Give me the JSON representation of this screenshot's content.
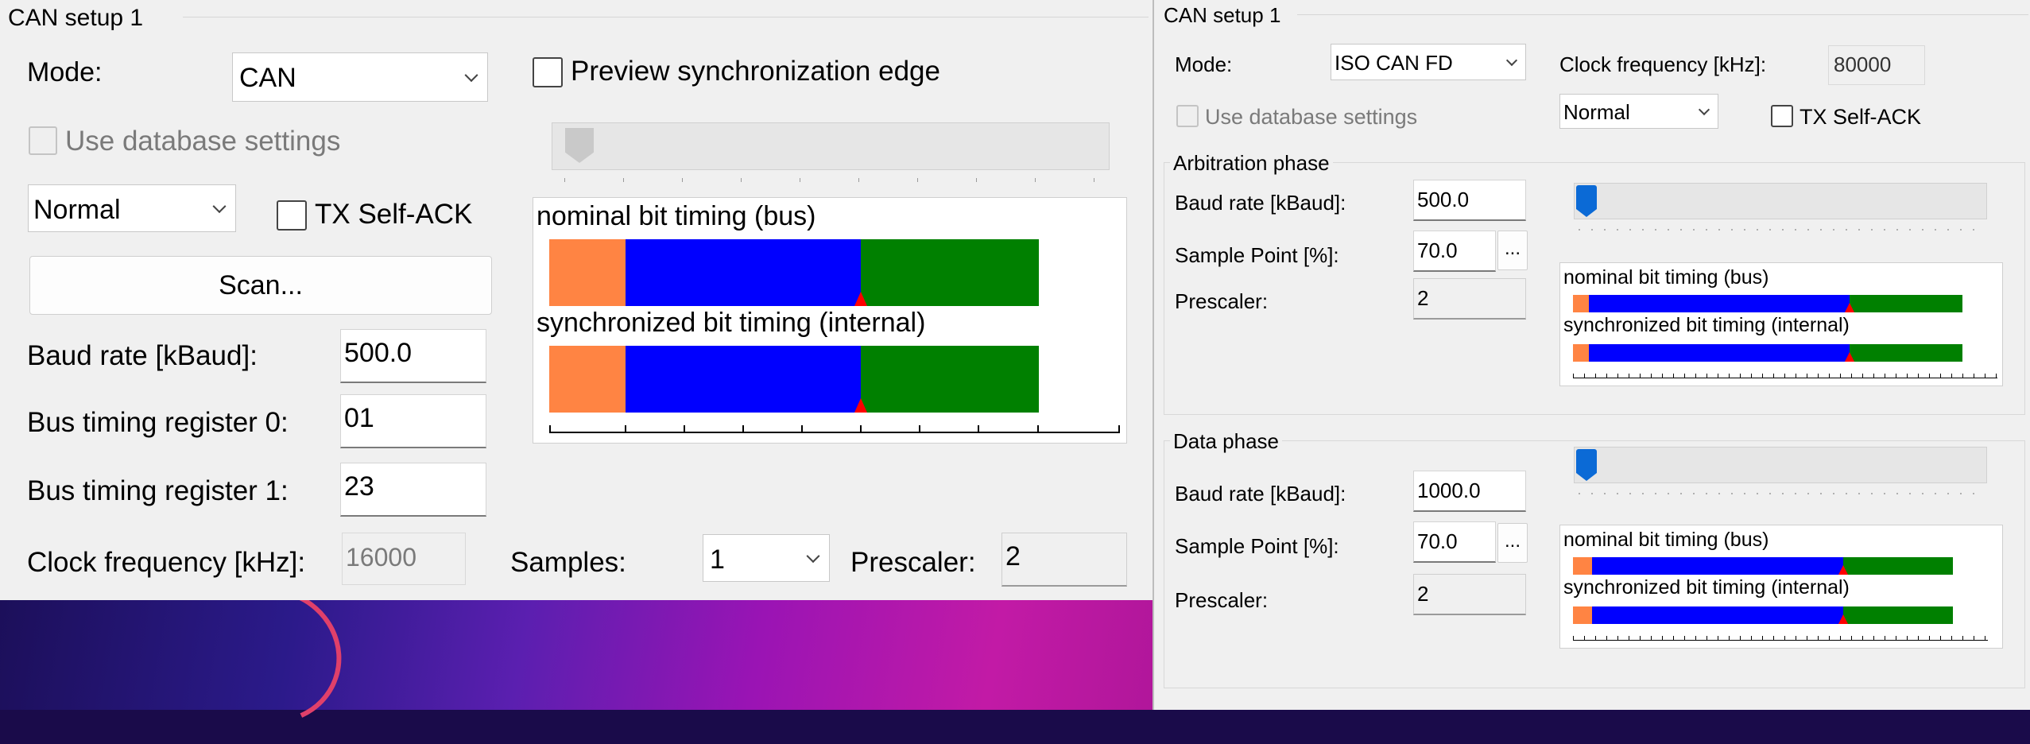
{
  "left": {
    "title": "CAN setup 1",
    "mode_label": "Mode:",
    "mode_value": "CAN",
    "preview_label": "Preview synchronization edge",
    "use_db_label": "Use database settings",
    "normal_value": "Normal",
    "tx_self_ack_label": "TX Self-ACK",
    "scan_label": "Scan...",
    "baud_label": "Baud rate [kBaud]:",
    "baud_value": "500.0",
    "btr0_label": "Bus timing register 0:",
    "btr0_value": "01",
    "btr1_label": "Bus timing register 1:",
    "btr1_value": "23",
    "clock_label": "Clock frequency [kHz]:",
    "clock_value": "16000",
    "samples_label": "Samples:",
    "samples_value": "1",
    "prescaler_label": "Prescaler:",
    "prescaler_value": "2",
    "nominal_label": "nominal bit timing (bus)",
    "sync_label": "synchronized bit timing (internal)"
  },
  "right": {
    "title": "CAN setup 1",
    "mode_label": "Mode:",
    "mode_value": "ISO CAN FD",
    "clock_label": "Clock frequency [kHz]:",
    "clock_value": "80000",
    "use_db_label": "Use database settings",
    "normal_value": "Normal",
    "tx_self_ack_label": "TX Self-ACK",
    "arbitration": {
      "title": "Arbitration phase",
      "baud_label": "Baud rate [kBaud]:",
      "baud_value": "500.0",
      "sample_label": "Sample Point [%]:",
      "sample_value": "70.0",
      "more_label": "...",
      "prescaler_label": "Prescaler:",
      "prescaler_value": "2",
      "nominal_label": "nominal bit timing (bus)",
      "sync_label": "synchronized bit timing (internal)"
    },
    "data": {
      "title": "Data phase",
      "baud_label": "Baud rate [kBaud]:",
      "baud_value": "1000.0",
      "sample_label": "Sample Point [%]:",
      "sample_value": "70.0",
      "more_label": "...",
      "prescaler_label": "Prescaler:",
      "prescaler_value": "2",
      "nominal_label": "nominal bit timing (bus)",
      "sync_label": "synchronized bit timing (internal)"
    }
  },
  "colors": {
    "sync_segment": "#ff8443",
    "phase1_segment": "#0000ff",
    "phase2_segment": "#008000",
    "sample_marker": "#ff0000",
    "slider_thumb": "#0b6ad6"
  }
}
